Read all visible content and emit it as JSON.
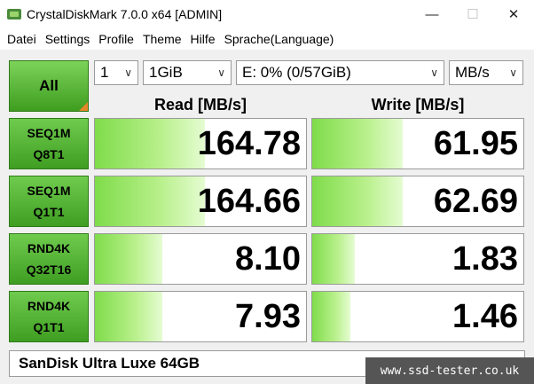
{
  "window": {
    "title": "CrystalDiskMark 7.0.0 x64 [ADMIN]",
    "minimize": "—",
    "maximize": "☐",
    "close": "✕"
  },
  "menu": [
    "Datei",
    "Settings",
    "Profile",
    "Theme",
    "Hilfe",
    "Sprache(Language)"
  ],
  "controls": {
    "all_label": "All",
    "count": "1",
    "size": "1GiB",
    "drive": "E: 0% (0/57GiB)",
    "unit": "MB/s"
  },
  "headers": {
    "read": "Read [MB/s]",
    "write": "Write [MB/s]"
  },
  "tests": [
    {
      "line1": "SEQ1M",
      "line2": "Q8T1",
      "read": "164.78",
      "write": "61.95",
      "read_level": 0.52,
      "write_level": 0.43
    },
    {
      "line1": "SEQ1M",
      "line2": "Q1T1",
      "read": "164.66",
      "write": "62.69",
      "read_level": 0.52,
      "write_level": 0.43
    },
    {
      "line1": "RND4K",
      "line2": "Q32T16",
      "read": "8.10",
      "write": "1.83",
      "read_level": 0.32,
      "write_level": 0.2
    },
    {
      "line1": "RND4K",
      "line2": "Q1T1",
      "read": "7.93",
      "write": "1.46",
      "read_level": 0.32,
      "write_level": 0.18
    }
  ],
  "footer": {
    "model": "SanDisk Ultra Luxe 64GB"
  },
  "watermark": "www.ssd-tester.co.uk",
  "colors": {
    "accent_green": "#3e9d1f",
    "bar_green": "#7fdc4a"
  }
}
